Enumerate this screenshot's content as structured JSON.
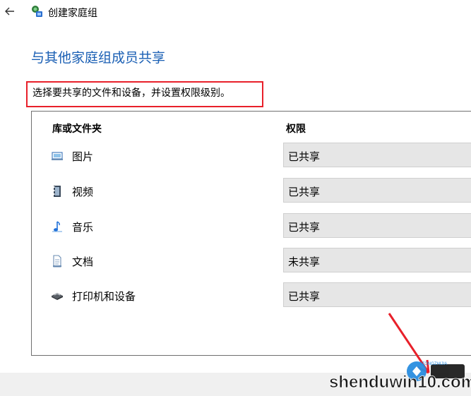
{
  "window": {
    "title": "创建家庭组"
  },
  "heading": "与其他家庭组成员共享",
  "instruction": "选择要共享的文件和设备，并设置权限级别。",
  "table": {
    "col_library": "库或文件夹",
    "col_permission": "权限",
    "rows": [
      {
        "label": "图片",
        "permission": "已共享",
        "icon": "pictures-icon"
      },
      {
        "label": "视频",
        "permission": "已共享",
        "icon": "videos-icon"
      },
      {
        "label": "音乐",
        "permission": "已共享",
        "icon": "music-icon"
      },
      {
        "label": "文档",
        "permission": "未共享",
        "icon": "documents-icon"
      },
      {
        "label": "打印机和设备",
        "permission": "已共享",
        "icon": "printer-icon"
      }
    ]
  },
  "watermark": {
    "text": "shenduwin10.com",
    "sub": "XITONGZHIJIA"
  },
  "colors": {
    "accent": "#1a5fb4",
    "highlight": "#e8202a",
    "select_bg": "#e6e6e6"
  }
}
